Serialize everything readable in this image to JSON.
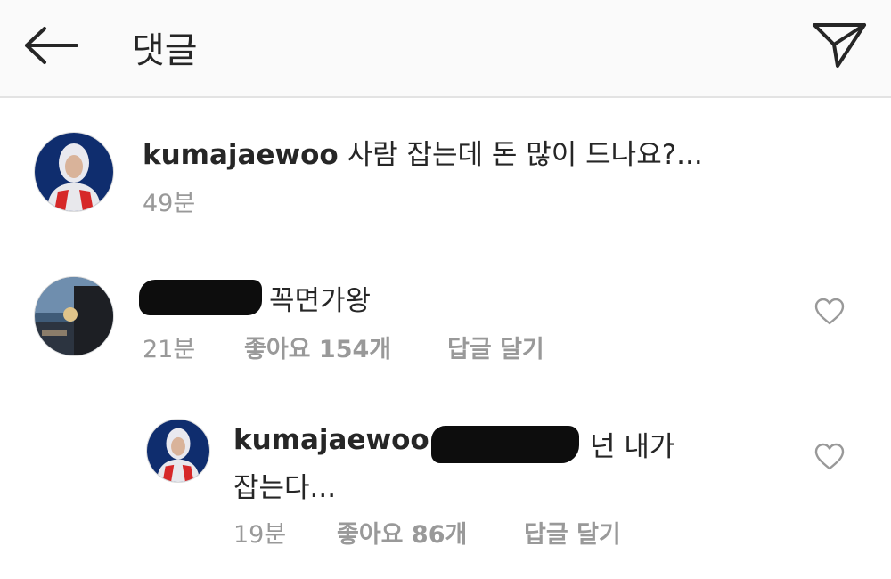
{
  "header": {
    "title": "댓글",
    "back_icon": "back-arrow-icon",
    "share_icon": "send-icon"
  },
  "caption": {
    "username": "kumajaewoo",
    "text": "사람 잡는데 돈 많이 드나요?...",
    "time": "49분"
  },
  "comment": {
    "text": "꼭면가왕",
    "time": "21분",
    "likes": "좋아요 154개",
    "reply_label": "답글 달기",
    "like_icon": "heart-outline-icon"
  },
  "reply": {
    "username": "kumajaewoo",
    "text_line1": "넌 내가",
    "text_line2": "잡는다...",
    "time": "19분",
    "likes": "좋아요 86개",
    "reply_label": "답글 달기",
    "like_icon": "heart-outline-icon"
  },
  "colors": {
    "header_bg": "#fafafa",
    "text": "#262626",
    "secondary": "#999999",
    "divider": "#e3e3e3"
  }
}
